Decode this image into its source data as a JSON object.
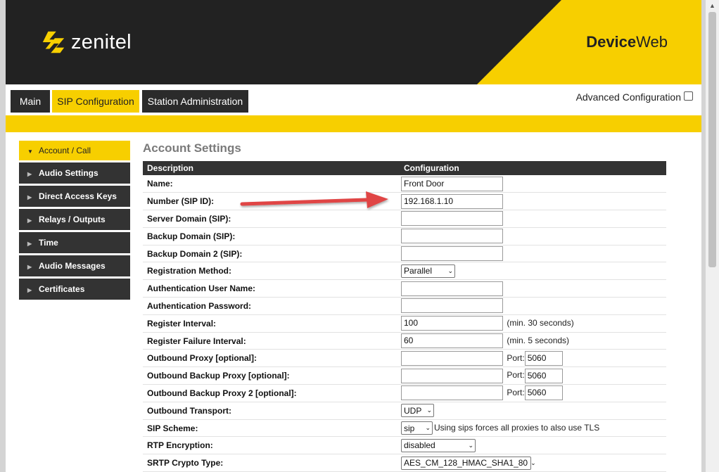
{
  "brand": {
    "name": "zenitel",
    "product_bold": "Device",
    "product_light": "Web"
  },
  "colors": {
    "accent": "#f7cf00",
    "dark": "#222222",
    "arrow": "#e04444"
  },
  "tabs": [
    {
      "label": "Main",
      "active": false
    },
    {
      "label": "SIP Configuration",
      "active": true
    },
    {
      "label": "Station Administration",
      "active": false
    }
  ],
  "advanced": {
    "label": "Advanced Configuration",
    "checked": false
  },
  "sidebar": {
    "items": [
      {
        "label": "Account / Call",
        "active": true
      },
      {
        "label": "Audio Settings"
      },
      {
        "label": "Direct Access Keys"
      },
      {
        "label": "Relays / Outputs"
      },
      {
        "label": "Time"
      },
      {
        "label": "Audio Messages"
      },
      {
        "label": "Certificates"
      }
    ]
  },
  "main": {
    "title": "Account Settings",
    "columns": [
      "Description",
      "Configuration"
    ],
    "rows": {
      "name": {
        "label": "Name:",
        "value": "Front Door"
      },
      "number": {
        "label": "Number (SIP ID):",
        "value": "192.168.1.10"
      },
      "server_domain": {
        "label": "Server Domain (SIP):",
        "value": ""
      },
      "backup_domain": {
        "label": "Backup Domain (SIP):",
        "value": ""
      },
      "backup_domain2": {
        "label": "Backup Domain 2 (SIP):",
        "value": ""
      },
      "reg_method": {
        "label": "Registration Method:",
        "value": "Parallel"
      },
      "auth_user": {
        "label": "Authentication User Name:",
        "value": ""
      },
      "auth_pass": {
        "label": "Authentication Password:",
        "value": ""
      },
      "reg_interval": {
        "label": "Register Interval:",
        "value": "100",
        "hint": "(min. 30 seconds)"
      },
      "reg_fail": {
        "label": "Register Failure Interval:",
        "value": "60",
        "hint": "(min. 5 seconds)"
      },
      "ob_proxy": {
        "label": "Outbound Proxy [optional]:",
        "value": "",
        "port_label": "Port:",
        "port": "5060"
      },
      "ob_backup": {
        "label": "Outbound Backup Proxy [optional]:",
        "value": "",
        "port_label": "Port:",
        "port": "5060"
      },
      "ob_backup2": {
        "label": "Outbound Backup Proxy 2 [optional]:",
        "value": "",
        "port_label": "Port:",
        "port": "5060"
      },
      "ob_transport": {
        "label": "Outbound Transport:",
        "value": "UDP"
      },
      "sip_scheme": {
        "label": "SIP Scheme:",
        "value": "sip",
        "hint": "Using sips forces all proxies to also use TLS"
      },
      "rtp_enc": {
        "label": "RTP Encryption:",
        "value": "disabled"
      },
      "srtp_crypto": {
        "label": "SRTP Crypto Type:",
        "value": "AES_CM_128_HMAC_SHA1_80"
      }
    }
  }
}
